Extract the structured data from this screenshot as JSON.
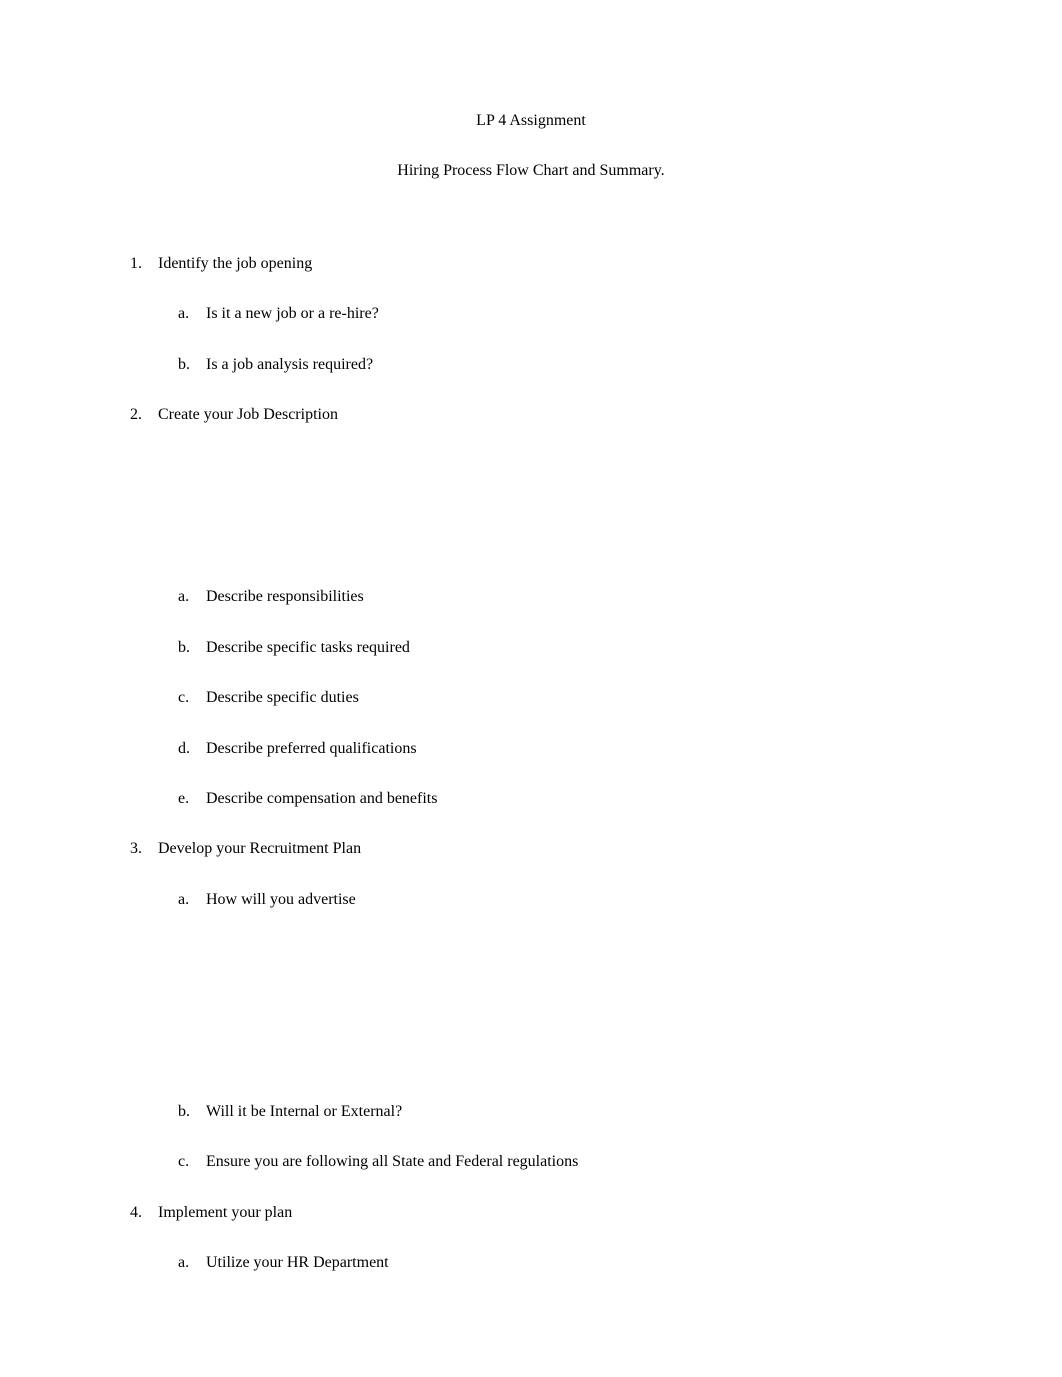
{
  "title": {
    "line1": "LP 4 Assignment",
    "line2": "Hiring Process Flow Chart and Summary."
  },
  "outline": {
    "item1": {
      "text": "Identify the job opening",
      "sub": {
        "a": "Is it a new job or a re-hire?",
        "b": "Is a job analysis required?"
      }
    },
    "item2": {
      "text": "Create your Job Description",
      "sub": {
        "a": "Describe responsibilities",
        "b": "Describe specific tasks required",
        "c": "Describe specific duties",
        "d": "Describe preferred qualifications",
        "e": "Describe compensation and benefits"
      }
    },
    "item3": {
      "text": "Develop your Recruitment Plan",
      "sub": {
        "a": "How will you advertise",
        "b": "Will it be Internal or External?",
        "c": "Ensure you are following all State and Federal regulations"
      }
    },
    "item4": {
      "text": "Implement your plan",
      "sub": {
        "a": "Utilize your HR Department"
      }
    }
  }
}
